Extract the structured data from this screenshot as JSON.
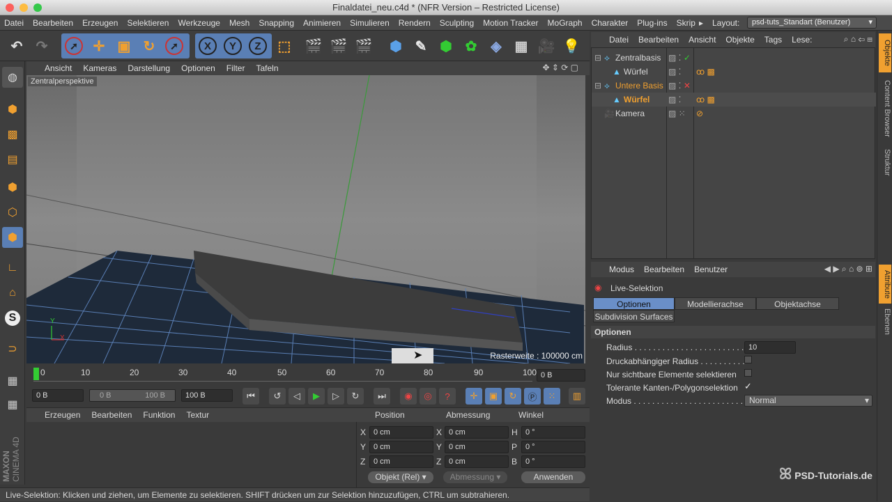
{
  "window": {
    "title": "Finaldatei_neu.c4d * (NFR Version – Restricted License)"
  },
  "menubar": {
    "items": [
      "Datei",
      "Bearbeiten",
      "Erzeugen",
      "Selektieren",
      "Werkzeuge",
      "Mesh",
      "Snapping",
      "Animieren",
      "Simulieren",
      "Rendern",
      "Sculpting",
      "Motion Tracker",
      "MoGraph",
      "Charakter",
      "Plug-ins",
      "Skrip"
    ],
    "layout_label": "Layout:",
    "layout_value": "psd-tuts_Standart (Benutzer)"
  },
  "viewport": {
    "menu": [
      "Ansicht",
      "Kameras",
      "Darstellung",
      "Optionen",
      "Filter",
      "Tafeln"
    ],
    "camera_label": "Zentralperspektive",
    "grid_info": "Rasterweite : 100000 cm",
    "axis_y": "Y",
    "axis_x": "X"
  },
  "timeline": {
    "ticks": [
      "0",
      "10",
      "20",
      "30",
      "40",
      "50",
      "60",
      "70",
      "80",
      "90",
      "100"
    ],
    "frame_end": "0 B"
  },
  "transport": {
    "start": "0 B",
    "range_start": "0 B",
    "range_end": "100 B",
    "end": "100 B"
  },
  "materials": {
    "menu": [
      "Erzeugen",
      "Bearbeiten",
      "Funktion",
      "Textur"
    ]
  },
  "coords": {
    "headers": [
      "Position",
      "Abmessung",
      "Winkel"
    ],
    "rows": [
      {
        "axis": "X",
        "pos": "0 cm",
        "size_axis": "X",
        "size": "0 cm",
        "rot_axis": "H",
        "rot": "0 °"
      },
      {
        "axis": "Y",
        "pos": "0 cm",
        "size_axis": "Y",
        "size": "0 cm",
        "rot_axis": "P",
        "rot": "0 °"
      },
      {
        "axis": "Z",
        "pos": "0 cm",
        "size_axis": "Z",
        "size": "0 cm",
        "rot_axis": "B",
        "rot": "0 °"
      }
    ],
    "mode": "Objekt (Rel)",
    "size_mode": "Abmessung",
    "apply": "Anwenden"
  },
  "status": {
    "text": "Live-Selektion: Klicken und ziehen, um Elemente zu selektieren. SHIFT drücken um zur Selektion hinzuzufügen, CTRL um subtrahieren."
  },
  "objmgr": {
    "menu": [
      "Datei",
      "Bearbeiten",
      "Ansicht",
      "Objekte",
      "Tags",
      "Lese:"
    ],
    "objects": [
      {
        "name": "Zentralbasis"
      },
      {
        "name": "Würfel"
      },
      {
        "name": "Untere Basis"
      },
      {
        "name": "Würfel"
      },
      {
        "name": "Kamera"
      }
    ]
  },
  "attr": {
    "menu": [
      "Modus",
      "Bearbeiten",
      "Benutzer"
    ],
    "tool": "Live-Selektion",
    "tabs": [
      "Optionen",
      "Modellierachse",
      "Objektachse",
      "Subdivision Surfaces"
    ],
    "section": "Optionen",
    "radius_label": "Radius . . . . . . . . . . . . . . . . . . . . . . . . .",
    "radius_value": "10",
    "pressure_label": "Druckabhängiger Radius . . . . . . . . . .",
    "visible_label": "Nur sichtbare Elemente selektieren",
    "tolerant_label": "Tolerante Kanten-/Polygonselektion",
    "mode_label": "Modus . . . . . . . . . . . . . . . . . . . . . . . . . .",
    "mode_value": "Normal"
  },
  "righttabs": [
    "Objekte",
    "Content Browser",
    "Struktur",
    "Attribute",
    "Ebenen"
  ],
  "brand": {
    "maxon": "MAXON",
    "cinema": "CINEMA 4D",
    "psd": "PSD-Tutorials.de"
  },
  "colors": {
    "accent": "#5a7fb5",
    "selected_tab": "#6a8fc8",
    "orange": "#f0a030"
  }
}
